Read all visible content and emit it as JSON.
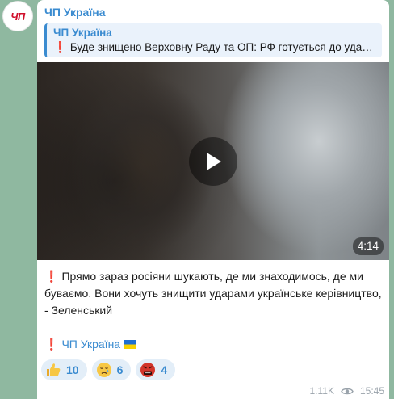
{
  "channel": {
    "avatar_text": "ЧП",
    "name": "ЧП Україна"
  },
  "reply": {
    "title": "ЧП Україна",
    "marker": "❗",
    "text": "Буде знищено Верховну Раду та ОП: РФ готується до уда…"
  },
  "video": {
    "duration": "4:14",
    "play_icon": "play-icon"
  },
  "message": {
    "marker": "❗",
    "text": "Прямо зараз росіяни шукають, де ми знаходимось, де ми буваємо. Вони хочуть знищити ударами українське керівництво, - Зеленський",
    "signature_marker": "❗",
    "signature_link": "ЧП Україна"
  },
  "reactions": [
    {
      "emoji": "thumbs-up",
      "count": "10"
    },
    {
      "emoji": "crying-face",
      "count": "6"
    },
    {
      "emoji": "angry-cursing-face",
      "count": "4"
    }
  ],
  "meta": {
    "views": "1.11K",
    "time": "15:45"
  },
  "colors": {
    "accent": "#3a8bd0",
    "alert": "#e0192b",
    "brand": "#d0102c",
    "background": "#8fb8a0"
  }
}
